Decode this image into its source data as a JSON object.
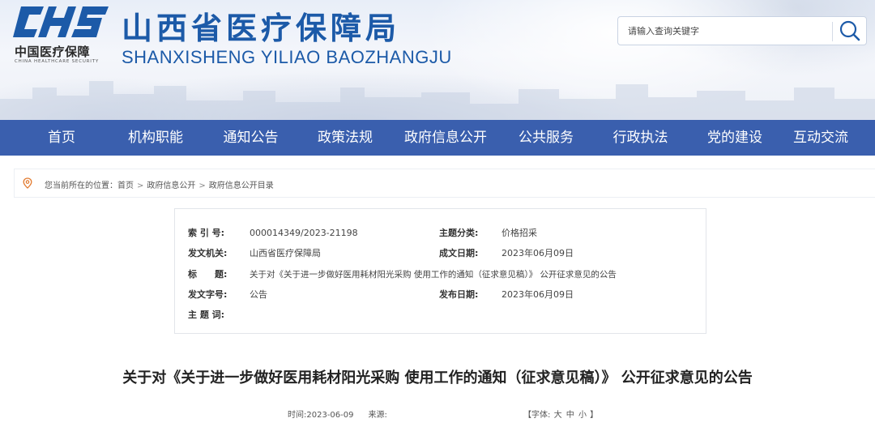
{
  "header": {
    "logo_cn": "中国医疗保障",
    "logo_en": "CHINA HEALTHCARE SECURITY",
    "title": "山西省医疗保障局",
    "subtitle": "SHANXISHENG YILIAO BAOZHANGJU",
    "brand_color": "#1c5aa8"
  },
  "search": {
    "placeholder": "请输入查询关键字",
    "icon": "search-icon"
  },
  "nav": {
    "color": "#3a5fae",
    "items": [
      "首页",
      "机构职能",
      "通知公告",
      "政策法规",
      "政府信息公开",
      "公共服务",
      "行政执法",
      "党的建设",
      "互动交流"
    ]
  },
  "breadcrumb": {
    "icon": "location-pin-icon",
    "prefix": "您当前所在的位置：",
    "items": [
      "首页",
      "政府信息公开",
      "政府信息公开目录"
    ],
    "separator": ">"
  },
  "info": {
    "index_label": "索 引 号:",
    "index_value": "000014349/2023-21198",
    "category_label": "主题分类:",
    "category_value": "价格招采",
    "issuer_label": "发文机关:",
    "issuer_value": "山西省医疗保障局",
    "created_label": "成文日期:",
    "created_value": "2023年06月09日",
    "title_label": "标　　题:",
    "title_value": "关于对《关于进一步做好医用耗材阳光采购 使用工作的通知（征求意见稿）》 公开征求意见的公告",
    "doc_no_label": "发文字号:",
    "doc_no_value": "公告",
    "published_label": "发布日期:",
    "published_value": "2023年06月09日",
    "keywords_label": "主 题 词:"
  },
  "article": {
    "title": "关于对《关于进一步做好医用耗材阳光采购 使用工作的通知（征求意见稿）》 公开征求意见的公告",
    "time": "时间:2023-06-09",
    "source": "来源:",
    "font_prefix": "【字体:",
    "font_large": "大",
    "font_medium": "中",
    "font_small": "小",
    "font_suffix": "】"
  }
}
